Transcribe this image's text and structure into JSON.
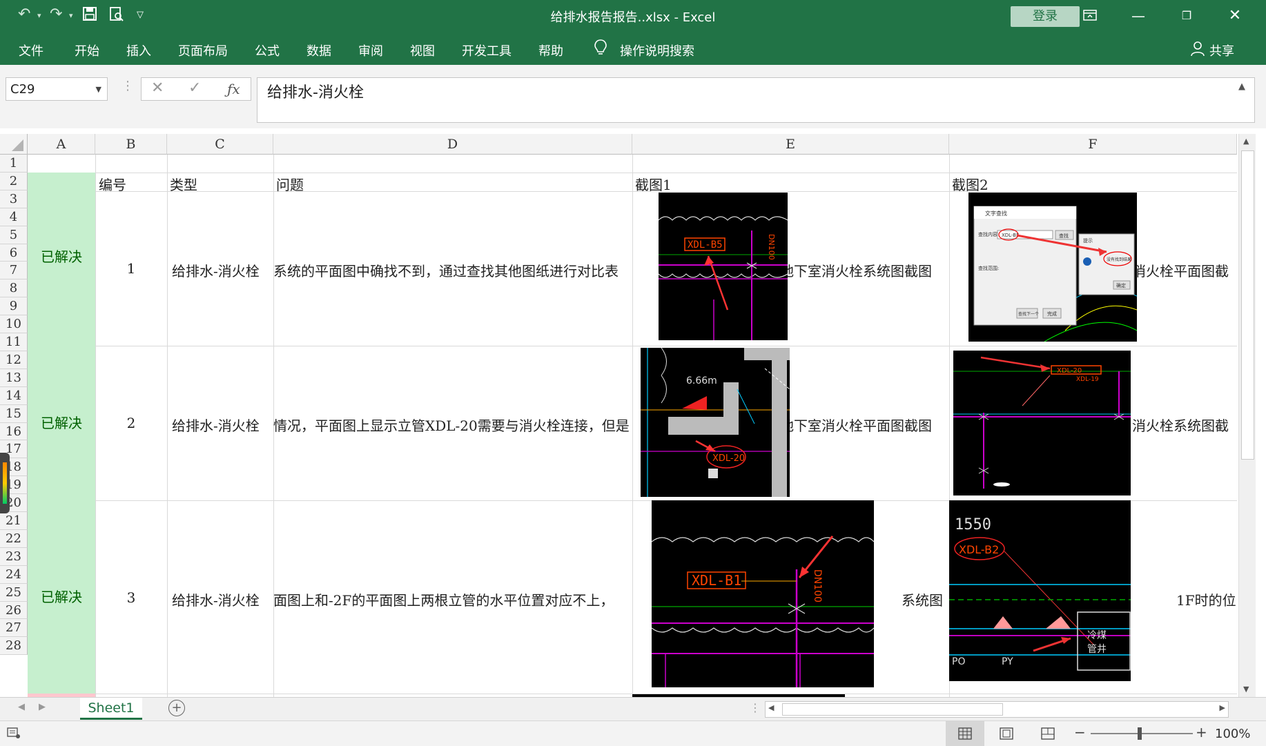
{
  "app": {
    "window_title": "给排水报告报告..xlsx  -  Excel",
    "login_label": "登录"
  },
  "ribbon": {
    "tabs": [
      "文件",
      "开始",
      "插入",
      "页面布局",
      "公式",
      "数据",
      "审阅",
      "视图",
      "开发工具",
      "帮助"
    ],
    "search_label": "操作说明搜索",
    "share_label": "共享"
  },
  "formula_bar": {
    "name_box": "C29",
    "formula": "给排水-消火栓"
  },
  "columns": [
    "A",
    "B",
    "C",
    "D",
    "E",
    "F"
  ],
  "rows": [
    "1",
    "2",
    "3",
    "4",
    "5",
    "6",
    "7",
    "8",
    "9",
    "10",
    "11",
    "12",
    "13",
    "14",
    "15",
    "16",
    "17",
    "18",
    "19",
    "20",
    "21",
    "22",
    "23",
    "24",
    "25",
    "26",
    "27",
    "28"
  ],
  "headers": {
    "number": "编号",
    "type": "类型",
    "issue": "问题",
    "shot1": "截图1",
    "shot2": "截图2"
  },
  "records": [
    {
      "status": "已解决",
      "number": "1",
      "type": "给排水-消火栓",
      "issue": "系统的平面图中确找不到，通过查找其他图纸进行对比表",
      "shot1_caption": "地下室消火栓系统图截图",
      "shot2_caption": "消火栓平面图截"
    },
    {
      "status": "已解决",
      "number": "2",
      "type": "给排水-消火栓",
      "issue": "情况，平面图上显示立管XDL-20需要与消火栓连接，但是",
      "shot1_caption": "地下室消火栓平面图截图",
      "shot2_caption": "消火栓系统图截"
    },
    {
      "status": "已解决",
      "number": "3",
      "type": "给排水-消火栓",
      "issue": "面图上和-2F的平面图上两根立管的水平位置对应不上，",
      "shot1_caption": "系统图",
      "shot2_caption": "1F时的位"
    }
  ],
  "cad_labels": {
    "r1_shot1": "XDL-B5",
    "r1_shot1_side": "DN100",
    "r1_shot2_dialog_title": "文字查找",
    "r1_shot2_find_label": "查找内容:",
    "r1_shot2_find_value": "XDL-B5",
    "r1_shot2_find_btn": "查找",
    "r1_shot2_range_label": "查找范围:",
    "r1_shot2_prev_btn": "查找下一个",
    "r1_shot2_done_btn": "完成",
    "r1_shot2_msg_title": "提示",
    "r1_shot2_msg": "没有找到结果",
    "r1_shot2_ok": "确定",
    "r2_shot1_dim": "6.66m",
    "r2_shot1": "XDL-20",
    "r2_shot2": "XDL-20",
    "r2_shot2_b": "XDL-19",
    "r3_shot1": "XDL-B1",
    "r3_shot1_side": "DN100",
    "r3_shot2_dim": "1550",
    "r3_shot2": "XDL-B2",
    "r3_shot2_po": "PO",
    "r3_shot2_py": "PY",
    "r3_shot2_room": "冷煤",
    "r3_shot2_room2": "管井"
  },
  "sheet_tabs": [
    "Sheet1"
  ],
  "status_bar": {
    "zoom_label": "100%"
  }
}
